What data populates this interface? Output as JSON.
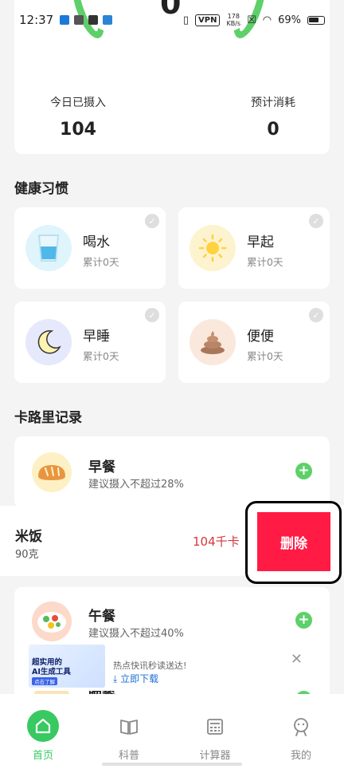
{
  "status_bar": {
    "time": "12:37",
    "vpn": "VPN",
    "speed_value": "178",
    "speed_unit": "KB/s",
    "battery": "69%"
  },
  "summary": {
    "center_value": "0",
    "intake_label": "今日已摄入",
    "intake_value": "104",
    "burn_label": "预计消耗",
    "burn_value": "0"
  },
  "habits": {
    "title": "健康习惯",
    "items": [
      {
        "name": "喝水",
        "sub": "累计0天",
        "icon": "water-glass-icon",
        "bg": "#dff4fb"
      },
      {
        "name": "早起",
        "sub": "累计0天",
        "icon": "sun-icon",
        "bg": "#fdf3cf"
      },
      {
        "name": "早睡",
        "sub": "累计0天",
        "icon": "moon-icon",
        "bg": "#e6e8fb"
      },
      {
        "name": "便便",
        "sub": "累计0天",
        "icon": "poop-icon",
        "bg": "#fbe8dc"
      }
    ]
  },
  "calorie": {
    "title": "卡路里记录",
    "breakfast": {
      "name": "早餐",
      "sub": "建议摄入不超过28%",
      "icon": "bread-icon"
    },
    "record": {
      "food": "米饭",
      "amount": "90克",
      "kcal": "104千卡",
      "delete_label": "删除"
    },
    "lunch": {
      "name": "午餐",
      "sub": "建议摄入不超过40%",
      "icon": "salad-icon"
    },
    "dinner": {
      "name": "晚餐",
      "icon": "bun-icon"
    }
  },
  "ad": {
    "image_line1": "超实用的",
    "image_line2": "AI生成工具",
    "image_button": "点击了解",
    "title": "热点快讯秒读送达!",
    "download": "立即下载"
  },
  "nav": {
    "items": [
      {
        "label": "首页",
        "icon": "home-icon",
        "active": true
      },
      {
        "label": "科普",
        "icon": "book-icon",
        "active": false
      },
      {
        "label": "计算器",
        "icon": "calculator-icon",
        "active": false
      },
      {
        "label": "我的",
        "icon": "profile-icon",
        "active": false
      }
    ]
  },
  "colors": {
    "accent": "#38c961",
    "delete": "#ff1b44",
    "kcal": "#d4343c"
  }
}
